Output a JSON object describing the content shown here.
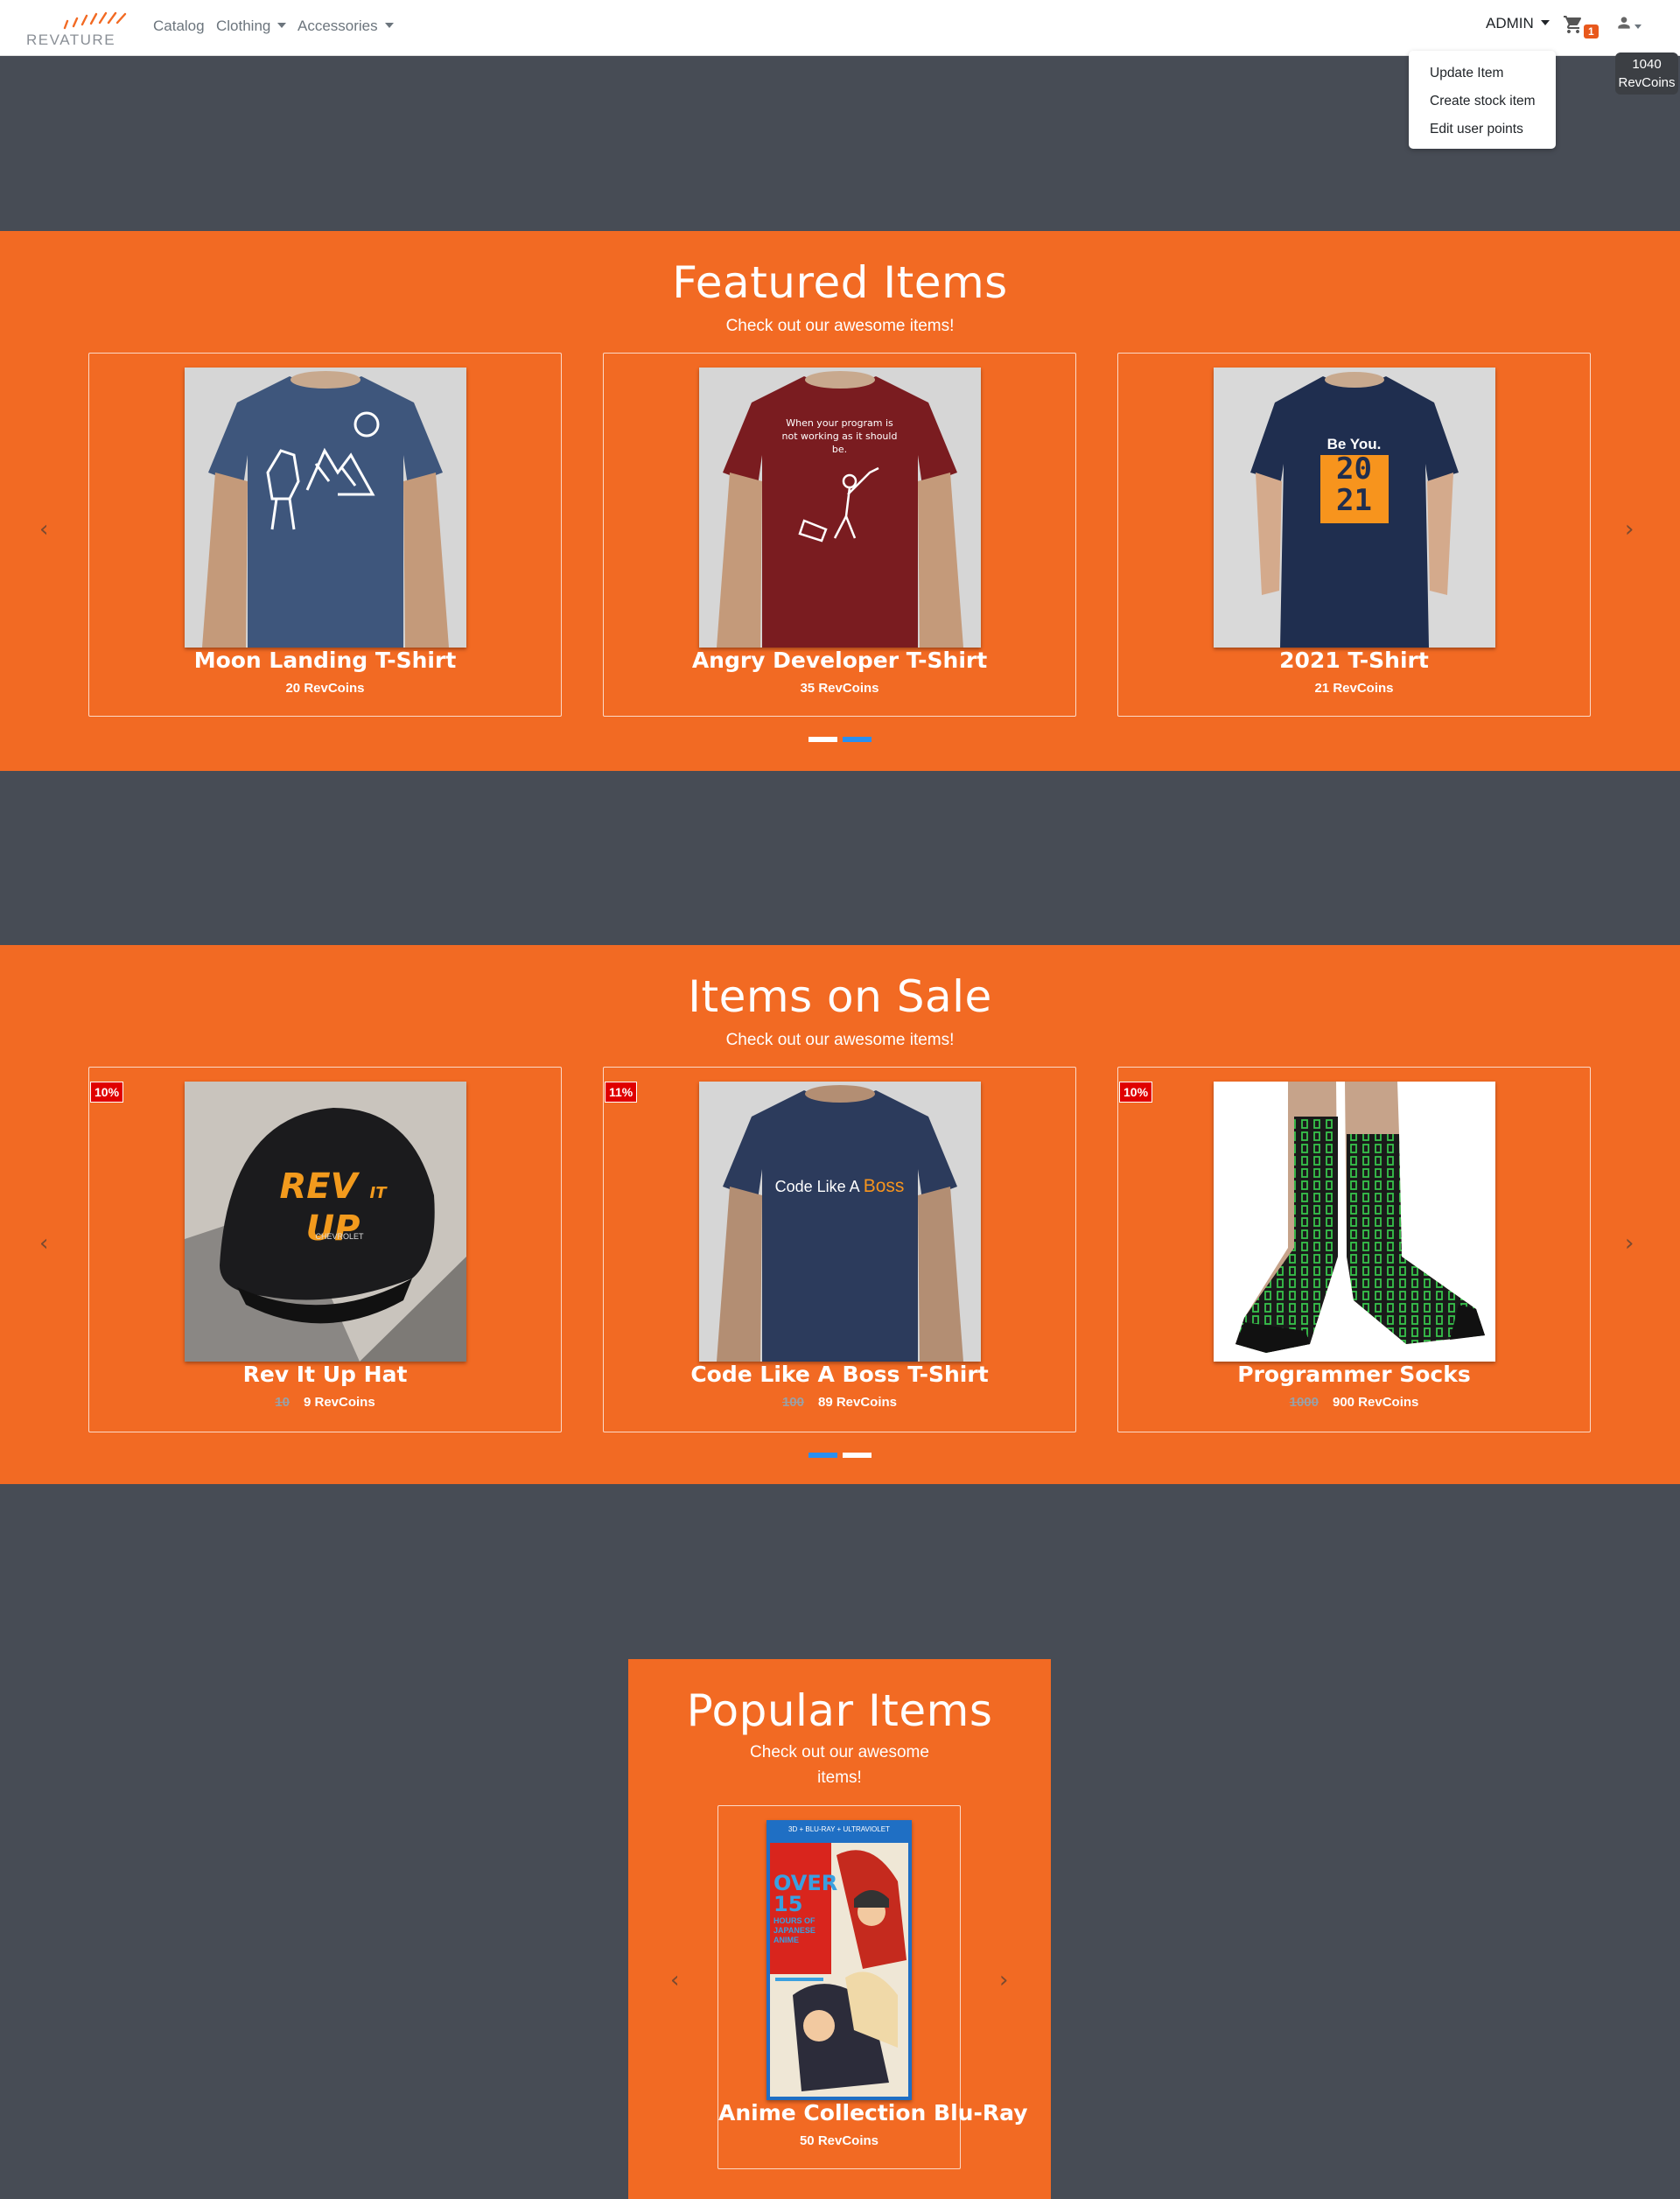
{
  "brand": {
    "name": "REVATURE",
    "accent": "#f26a23"
  },
  "nav": {
    "links": [
      {
        "label": "Catalog",
        "dropdown": false
      },
      {
        "label": "Clothing",
        "dropdown": true
      },
      {
        "label": "Accessories",
        "dropdown": true
      }
    ],
    "admin_label": "ADMIN",
    "cart_icon": "cart-icon",
    "cart_count": "1",
    "user_icon": "user-icon",
    "coins_value": "1040",
    "coins_unit": "RevCoins"
  },
  "admin_menu": {
    "items": [
      "Update Item",
      "Create stock item",
      "Edit user points"
    ]
  },
  "featured": {
    "title": "Featured Items",
    "subtitle": "Check out our awesome items!",
    "items": [
      {
        "name": "Moon Landing T-Shirt",
        "price": "20 RevCoins"
      },
      {
        "name": "Angry Developer T-Shirt",
        "price": "35 RevCoins",
        "shirt_text": "When your program is not working as it should be."
      },
      {
        "name": "2021 T-Shirt",
        "price": "21 RevCoins",
        "shirt_text": "Be You.",
        "shirt_digits": [
          "20",
          "21"
        ]
      }
    ]
  },
  "sale": {
    "title": "Items on Sale",
    "subtitle": "Check out our awesome items!",
    "items": [
      {
        "name": "Rev It Up Hat",
        "badge": "10%",
        "old_price": "10",
        "price": "9 RevCoins",
        "hat_text": [
          "REV",
          "IT",
          "UP"
        ],
        "hat_sub": "CHEVROLET"
      },
      {
        "name": "Code Like A Boss T-Shirt",
        "badge": "11%",
        "old_price": "100",
        "price": "89 RevCoins",
        "shirt_text": "Code Like A",
        "shirt_accent": "Boss"
      },
      {
        "name": "Programmer Socks",
        "badge": "10%",
        "old_price": "1000",
        "price": "900 RevCoins"
      }
    ]
  },
  "popular": {
    "title": "Popular Items",
    "subtitle_line1": "Check out our awesome",
    "subtitle_line2": "items!",
    "items": [
      {
        "name": "Anime Collection Blu-Ray",
        "price": "50 RevCoins",
        "cover_top": "3D + BLU-RAY + ULTRAVIOLET",
        "cover_big": [
          "OVER",
          "15"
        ],
        "cover_small": [
          "HOURS OF",
          "JAPANESE",
          "ANIME"
        ]
      }
    ]
  },
  "carousel": {
    "prev_icon": "chevron-left-icon",
    "next_icon": "chevron-right-icon"
  }
}
